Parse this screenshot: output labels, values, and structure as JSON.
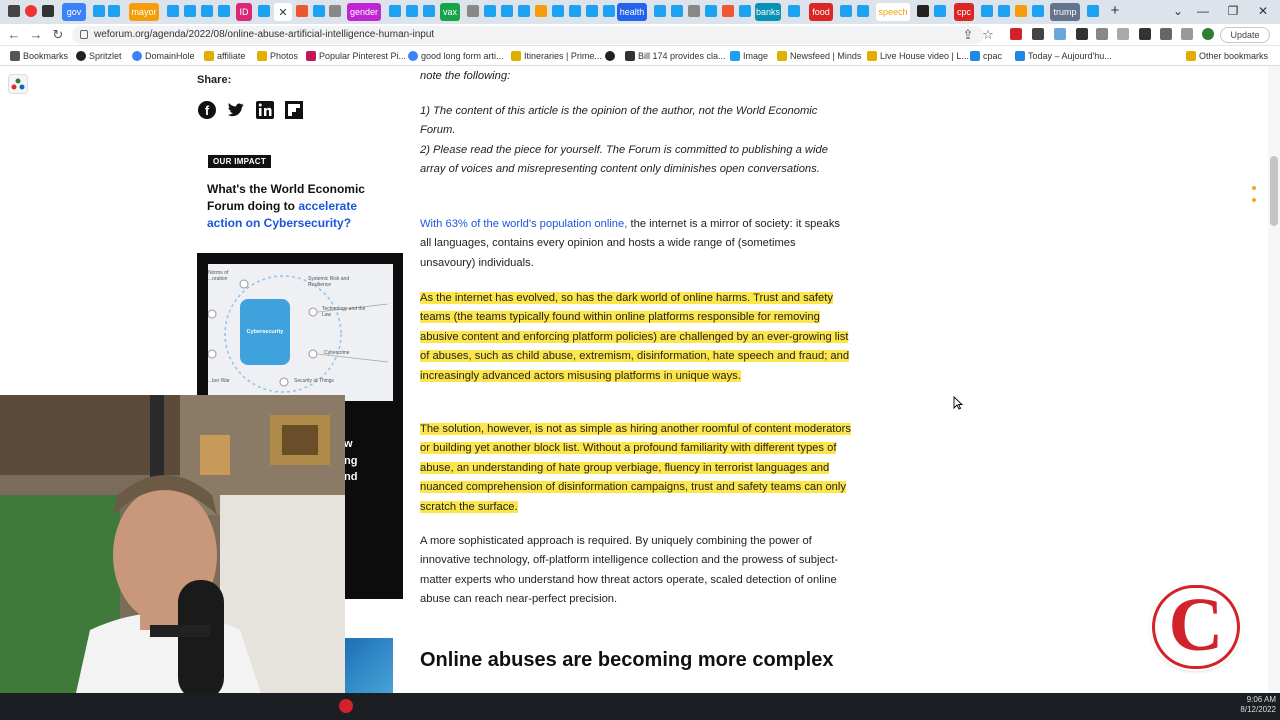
{
  "browser": {
    "tabs": [
      {
        "label": "gov",
        "color": "#3b82f6"
      },
      {
        "label": "mayor",
        "color": "#f59e0b"
      },
      {
        "label": "ID",
        "color": "#db2777"
      },
      {
        "label": "gender",
        "color": "#c026d3"
      },
      {
        "label": "vax",
        "color": "#16a34a"
      },
      {
        "label": "health",
        "color": "#2563eb"
      },
      {
        "label": "banks",
        "color": "#0891b2"
      },
      {
        "label": "food",
        "color": "#dc2626"
      },
      {
        "label": "speech",
        "color": "#f59e0b"
      },
      {
        "label": "cpc",
        "color": "#dc2626"
      },
      {
        "label": "trump",
        "color": "#64748b"
      }
    ],
    "url": "weforum.org/agenda/2022/08/online-abuse-artificial-intelligence-human-input",
    "update_label": "Update",
    "bookmarks": [
      "Bookmarks",
      "Spritzlet",
      "DomainHole",
      "affiliate",
      "Photos",
      "Popular Pinterest Pi...",
      "good long form arti...",
      "Itineraries | Prime...",
      "Bill 174 provides cla...",
      "Image",
      "Newsfeed | Minds",
      "Live House video | L...",
      "cpac",
      "Today – Aujourd'hu...",
      "Other bookmarks"
    ]
  },
  "sidebar": {
    "share_label": "Share:",
    "share_icons": [
      "facebook-icon",
      "twitter-icon",
      "linkedin-icon",
      "flipboard-icon"
    ],
    "impact_badge": "OUR IMPACT",
    "impact_prefix": "What's the World Economic Forum doing to ",
    "impact_link": "accelerate action on Cybersecurity?",
    "promo_img_labels": [
      "Norms of ...oration",
      "Systemic Risk and Resilience",
      "Technology and the Law",
      "Cybersecurity",
      "Cybercrime",
      "...ber War",
      "Security of Things"
    ],
    "promo_text_partial": [
      "w",
      "ng",
      "nd"
    ]
  },
  "article": {
    "para0": "note the following:",
    "para1": "1) The content of this article is the opinion of the author, not the World Economic Forum.",
    "para2": "2) Please read the piece for yourself. The Forum is committed to publishing a wide array of voices and misrepresenting content only diminishes open conversations.",
    "para3_link": "With 63% of the world's population online,",
    "para3_rest": " the internet is a mirror of society: it speaks all languages, contains every opinion and hosts a wide range of (sometimes unsavoury) individuals.",
    "para4": "As the internet has evolved, so has the dark world of online harms. Trust and safety teams (the teams typically found within online platforms responsible for removing abusive content and enforcing platform policies) are challenged by an ever-growing list of abuses, such as child abuse, extremism, disinformation, hate speech and fraud; and increasingly advanced actors misusing platforms in unique ways.",
    "para5": "The solution, however, is not as simple as hiring another roomful of content moderators or building yet another block list. Without a profound familiarity with different types of abuse, an understanding of hate group verbiage, fluency in terrorist languages and nuanced comprehension of disinformation campaigns, trust and safety teams can only scratch the surface.",
    "para6": "A more sophisticated approach is required. By uniquely combining the power of innovative technology, off-platform intelligence collection and the prowess of subject-matter experts who understand how threat actors operate, scaled detection of online abuse can reach near-perfect precision.",
    "heading": "Online abuses are becoming more complex"
  },
  "overlay": {
    "logo_letter": "C",
    "clock_time": "9:06 AM",
    "clock_date": "8/12/2022"
  },
  "colors": {
    "highlight": "#fde64b",
    "link": "#1a56db",
    "logo": "#d2232a"
  }
}
